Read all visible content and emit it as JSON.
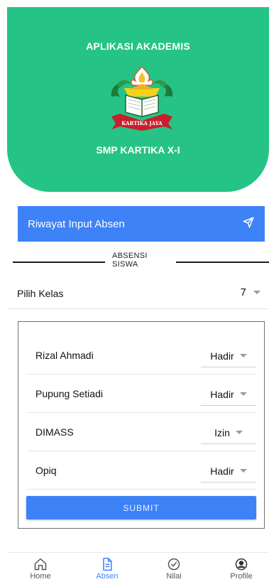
{
  "header": {
    "title": "APLIKASI AKADEMIS",
    "logo_text": "KARTIKA JAYA",
    "school": "SMP KARTIKA X-I"
  },
  "history_button": {
    "label": "Riwayat Input Absen",
    "icon": "send-icon"
  },
  "section_divider": {
    "line1": "ABSENSI",
    "line2": "SISWA"
  },
  "class_picker": {
    "label": "Pilih Kelas",
    "value": "7"
  },
  "students": [
    {
      "name": "Rizal Ahmadi",
      "status": "Hadir"
    },
    {
      "name": "Pupung Setiadi",
      "status": "Hadir"
    },
    {
      "name": "DIMASS",
      "status": "Izin"
    },
    {
      "name": "Opiq",
      "status": "Hadir"
    }
  ],
  "submit_label": "SUBMIT",
  "nav": [
    {
      "label": "Home",
      "icon": "home-icon",
      "active": false
    },
    {
      "label": "Absen",
      "icon": "document-icon",
      "active": true
    },
    {
      "label": "Nilai",
      "icon": "check-circle-icon",
      "active": false
    },
    {
      "label": "Profile",
      "icon": "profile-icon",
      "active": false
    }
  ],
  "colors": {
    "header_green": "#26c386",
    "primary_blue": "#3d82f7",
    "nav_inactive": "#555555"
  }
}
